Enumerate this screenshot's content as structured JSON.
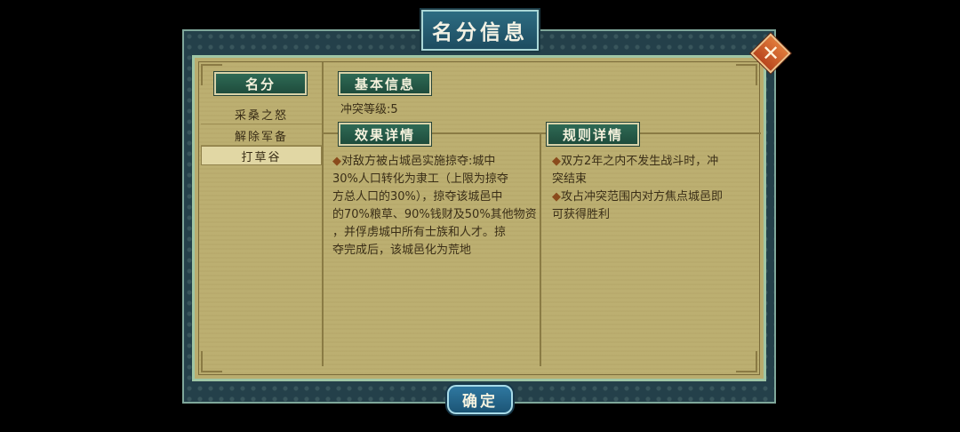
{
  "dialog": {
    "title": "名分信息",
    "close_symbol": "✕",
    "confirm_label": "确定"
  },
  "left_panel": {
    "header": "名分",
    "items": [
      {
        "label": "采桑之怒",
        "selected": false
      },
      {
        "label": "解除军备",
        "selected": false
      },
      {
        "label": "打草谷",
        "selected": true
      }
    ]
  },
  "basic_info": {
    "header": "基本信息",
    "conflict_level": "冲突等级:5"
  },
  "effect": {
    "header": "效果详情",
    "bullet": "◆",
    "lines": [
      "对敌方被占城邑实施掠夺:城中",
      "30%人口转化为隶工（上限为掠夺",
      "方总人口的30%），掠夺该城邑中",
      "的70%粮草、90%钱财及50%其他物资",
      "，并俘虏城中所有士族和人才。掠",
      "夺完成后，该城邑化为荒地"
    ]
  },
  "rules": {
    "header": "规则详情",
    "bullet": "◆",
    "rule1_lines": [
      "双方2年之内不发生战斗时，冲",
      "突结束"
    ],
    "rule2_lines": [
      "攻占冲突范围内对方焦点城邑即",
      "可获得胜利"
    ]
  },
  "colors": {
    "frame": "#24404a",
    "paper": "#bcaf71",
    "plate": "#2e6a55",
    "accent_close": "#c85a26"
  }
}
